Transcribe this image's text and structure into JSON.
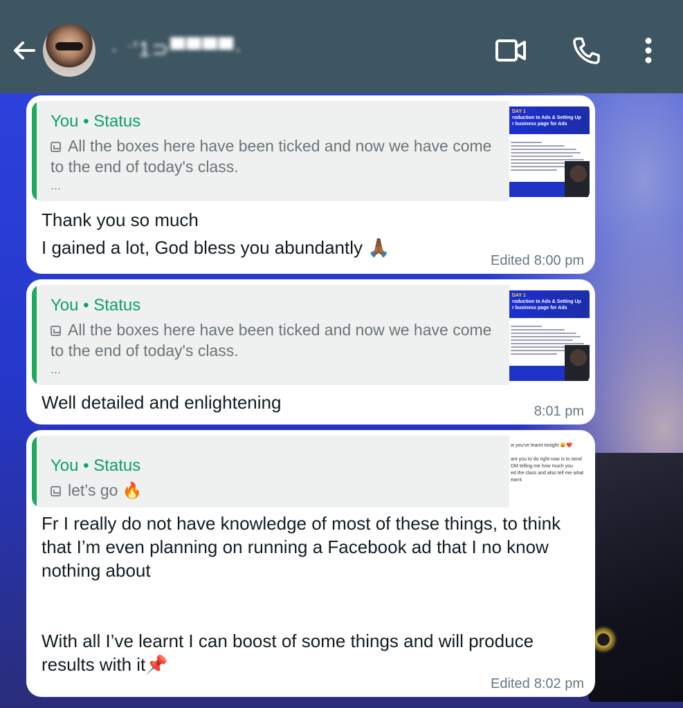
{
  "header": {
    "contact_name": "·  ˑ′1⊃▀▀▀▀·",
    "back_icon": "back-arrow-icon",
    "video_icon": "video-call-icon",
    "call_icon": "phone-icon",
    "menu_icon": "more-vert-icon",
    "bg_color": "#3e5562"
  },
  "messages": [
    {
      "quote_author": "You • Status",
      "quote_text": "All the boxes here have been ticked and now we have come to the end of today's class.",
      "quote_more": "...",
      "thumb_title": "DAY 1",
      "thumb_subtitle": "roduction to Ads & Setting Up\nr business page for Ads",
      "text": "Thank you so much\nI gained a lot, God bless you abundantly 🙏🏾",
      "edited": "Edited",
      "time": "8:00 pm"
    },
    {
      "quote_author": "You • Status",
      "quote_text": "All the boxes here have been ticked and now we have come to the end of today's class.",
      "quote_more": "...",
      "thumb_title": "DAY 1",
      "thumb_subtitle": "roduction to Ads & Setting Up\nr business page for Ads",
      "text": "Well detailed and enlightening",
      "time": "8:01 pm"
    },
    {
      "quote_author": "You • Status",
      "quote_text": "let’s go 🔥",
      "thumb_text": "w you've learnt tonight 😀❤️\n\nant you to do right now is to send\n DM telling me how much you\ned the class and also tell me what\nearnt",
      "text": "Fr I really do not have knowledge of most of these things, to think that I’m even planning on running a Facebook ad that I no know nothing about\n\n\nWith all I’ve learnt I can boost of some things and will produce results with it📌",
      "edited": "Edited",
      "time": "8:02 pm"
    }
  ],
  "colors": {
    "quote_author": "#0d9e6e",
    "quote_bar": "#1daa61",
    "bubble": "#ffffff",
    "meta": "#667781"
  }
}
